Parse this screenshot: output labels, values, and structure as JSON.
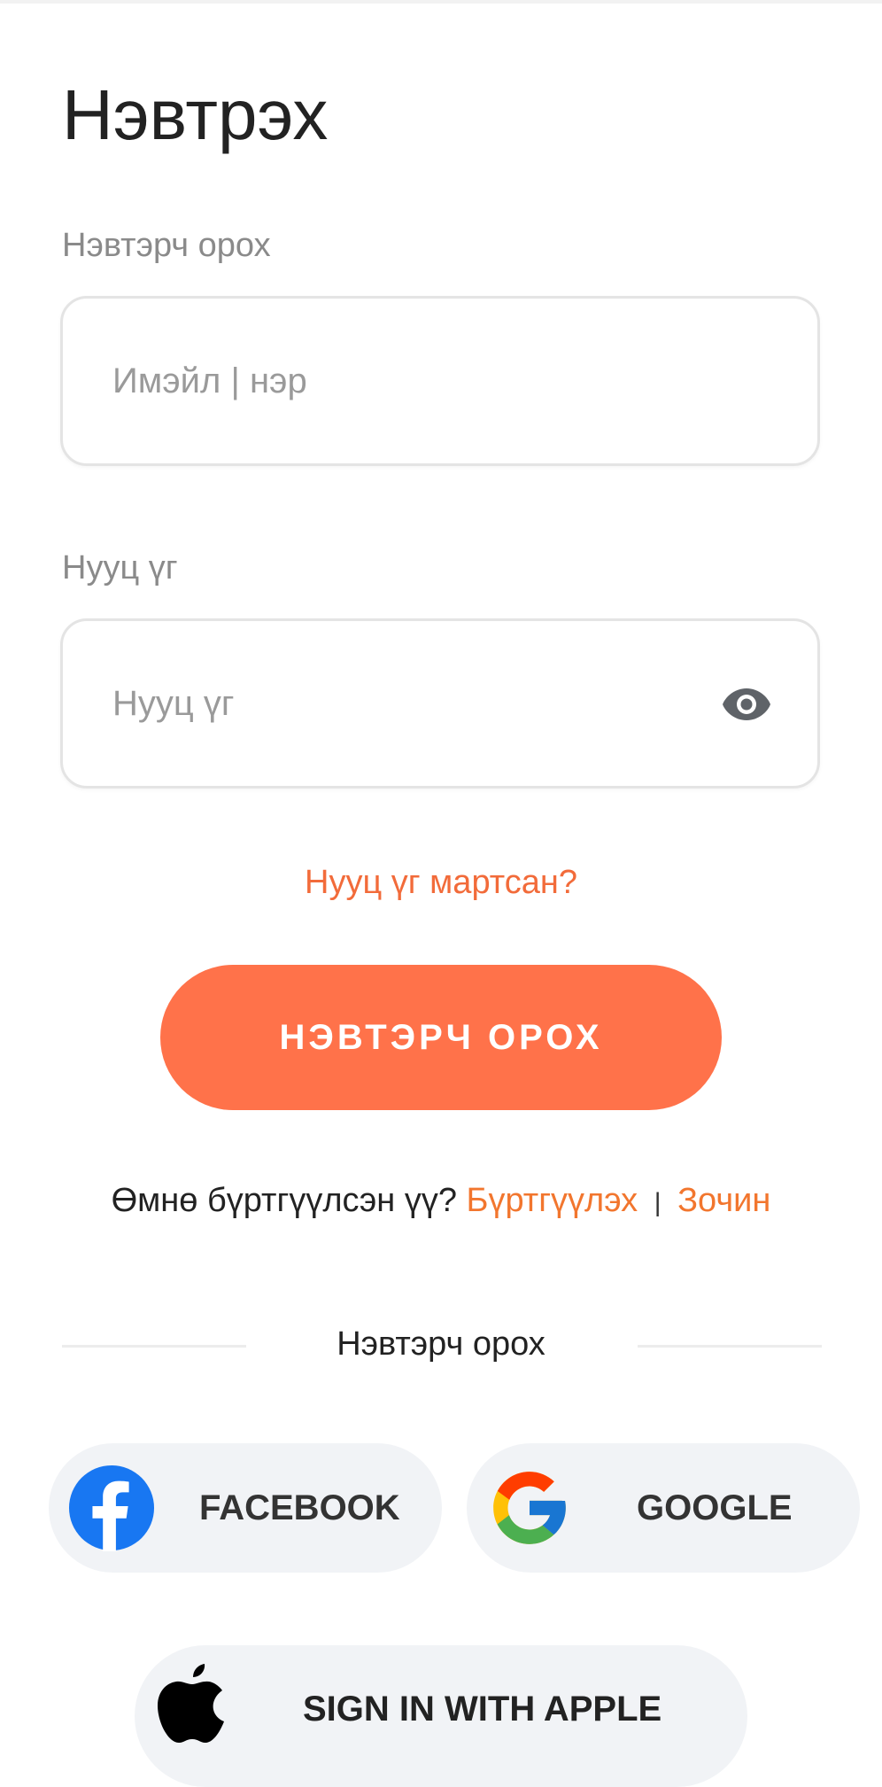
{
  "page": {
    "title": "Нэвтрэх"
  },
  "login_form": {
    "username_label": "Нэвтэрч орох",
    "username_placeholder": "Имэйл | нэр",
    "password_label": "Нууц үг",
    "password_placeholder": "Нууц үг",
    "password_visibility_icon": "eye-icon",
    "forgot_password": "Нууц үг мартсан?",
    "submit_label": "НЭВТЭРЧ ОРОХ"
  },
  "register": {
    "prompt": "Өмнө бүртгүүлсэн үү?",
    "register_link": "Бүртгүүлэх",
    "separator": "|",
    "guest_link": "Зочин"
  },
  "social": {
    "divider_label": "Нэвтэрч орох",
    "facebook_label": "FACEBOOK",
    "google_label": "GOOGLE",
    "apple_label": "SIGN IN WITH APPLE"
  },
  "colors": {
    "accent": "#ff724a",
    "link": "#f2762e",
    "facebook_blue": "#1877f2",
    "social_button_bg": "#f1f3f6"
  }
}
